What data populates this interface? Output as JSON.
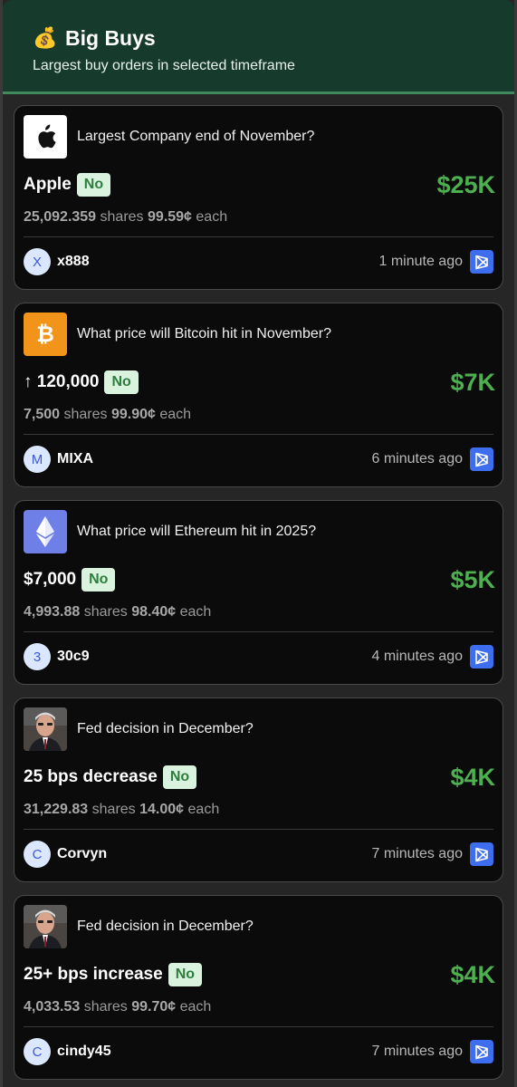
{
  "header": {
    "icon": "money-bag-icon",
    "title": "Big Buys",
    "subtitle": "Largest buy orders in selected timeframe"
  },
  "colors": {
    "header_bg": "#163a2c",
    "amount_green": "#4caf50",
    "badge_bg": "#d9f3df",
    "badge_text": "#2e7d3e",
    "link_blue": "#3d6ef0"
  },
  "trades": [
    {
      "logo": "apple-logo-icon",
      "question": "Largest Company end of November?",
      "outcome": "Apple",
      "side": "No",
      "amount": "$25K",
      "shares": "25,092.359",
      "shares_word": "shares",
      "price": "99.59¢",
      "each_word": "each",
      "user_initial": "X",
      "username": "x888",
      "time": "1 minute ago"
    },
    {
      "logo": "bitcoin-logo-icon",
      "question": "What price will Bitcoin hit in November?",
      "outcome": "↑ 120,000",
      "side": "No",
      "amount": "$7K",
      "shares": "7,500",
      "shares_word": "shares",
      "price": "99.90¢",
      "each_word": "each",
      "user_initial": "M",
      "username": "MIXA",
      "time": "6 minutes ago"
    },
    {
      "logo": "ethereum-logo-icon",
      "question": "What price will Ethereum hit in 2025?",
      "outcome": "$7,000",
      "side": "No",
      "amount": "$5K",
      "shares": "4,993.88",
      "shares_word": "shares",
      "price": "98.40¢",
      "each_word": "each",
      "user_initial": "3",
      "username": "30c9",
      "time": "4 minutes ago"
    },
    {
      "logo": "fed-chair-portrait",
      "question": "Fed decision in December?",
      "outcome": "25 bps decrease",
      "side": "No",
      "amount": "$4K",
      "shares": "31,229.83",
      "shares_word": "shares",
      "price": "14.00¢",
      "each_word": "each",
      "user_initial": "C",
      "username": "Corvyn",
      "time": "7 minutes ago"
    },
    {
      "logo": "fed-chair-portrait",
      "question": "Fed decision in December?",
      "outcome": "25+ bps increase",
      "side": "No",
      "amount": "$4K",
      "shares": "4,033.53",
      "shares_word": "shares",
      "price": "99.70¢",
      "each_word": "each",
      "user_initial": "C",
      "username": "cindy45",
      "time": "7 minutes ago"
    }
  ]
}
